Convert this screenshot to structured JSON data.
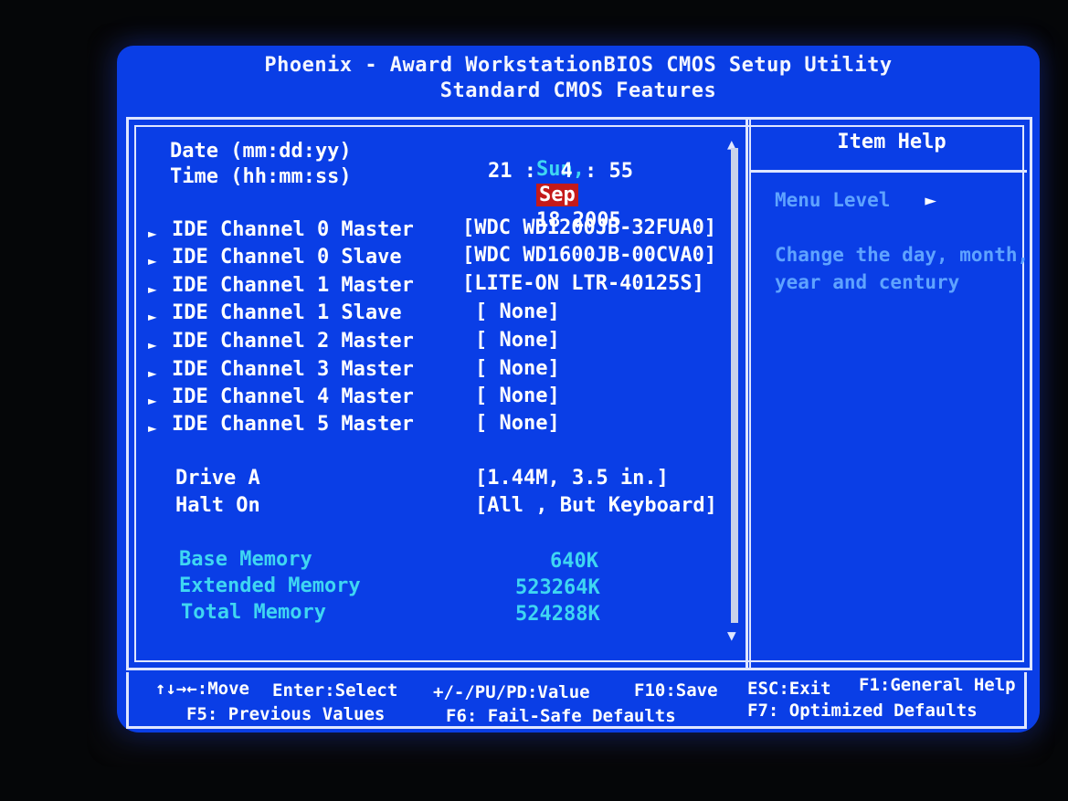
{
  "header": {
    "title": "Phoenix - Award WorkstationBIOS CMOS Setup Utility",
    "subtitle": "Standard CMOS Features"
  },
  "main": {
    "date": {
      "label": "Date (mm:dd:yy)",
      "weekday": "Sun,",
      "month": "Sep",
      "day_year": "18 2005"
    },
    "time": {
      "label": "Time (hh:mm:ss)",
      "value": "21 :  4 : 55"
    },
    "ide_channels": [
      {
        "label": "IDE Channel 0 Master",
        "value": "[WDC WD1200JB-32FUA0]"
      },
      {
        "label": "IDE Channel 0 Slave",
        "value": "[WDC WD1600JB-00CVA0]"
      },
      {
        "label": "IDE Channel 1 Master",
        "value": "[LITE-ON LTR-40125S]"
      },
      {
        "label": "IDE Channel 1 Slave",
        "value": "[ None]"
      },
      {
        "label": "IDE Channel 2 Master",
        "value": "[ None]"
      },
      {
        "label": "IDE Channel 3 Master",
        "value": "[ None]"
      },
      {
        "label": "IDE Channel 4 Master",
        "value": "[ None]"
      },
      {
        "label": "IDE Channel 5 Master",
        "value": "[ None]"
      }
    ],
    "drive_a": {
      "label": "Drive A",
      "value": "[1.44M, 3.5 in.]"
    },
    "halt_on": {
      "label": "Halt On",
      "value": "[All , But Keyboard]"
    },
    "memory": [
      {
        "label": "Base Memory",
        "value": "640K"
      },
      {
        "label": "Extended Memory",
        "value": "523264K"
      },
      {
        "label": "Total Memory",
        "value": "524288K"
      }
    ]
  },
  "help": {
    "title": "Item Help",
    "menu_level": "Menu Level",
    "menu_level_arrow": "►",
    "text_line1": "Change the day, month,",
    "text_line2": "year and century"
  },
  "footer": {
    "move": "↑↓→←:Move",
    "enter": "Enter:Select",
    "value": "+/-/PU/PD:Value",
    "save": "F10:Save",
    "exit": "ESC:Exit",
    "general_help": "F1:General Help",
    "previous": "F5: Previous Values",
    "failsafe": "F6: Fail-Safe Defaults",
    "optimized": "F7: Optimized Defaults"
  },
  "icons": {
    "submenu_arrow": "►",
    "scroll_up": "▲",
    "scroll_down": "▼"
  },
  "colors": {
    "background": "#0a3ee6",
    "highlight": "#c41a1a",
    "cyan_text": "#3fd6f2",
    "help_text": "#5fa3ff"
  }
}
